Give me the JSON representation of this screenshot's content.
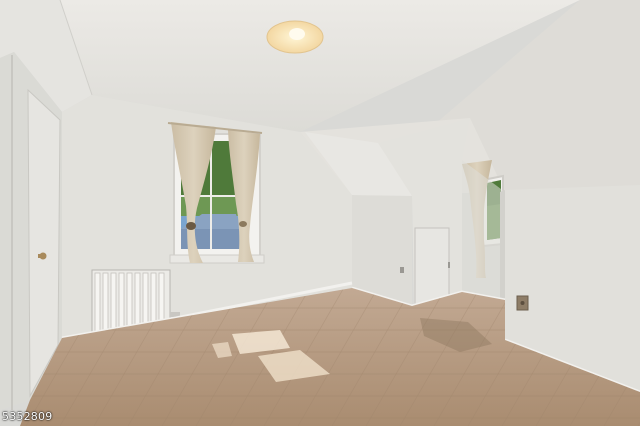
{
  "photo": {
    "listing_id": "5352809"
  },
  "palette": {
    "ceiling": "#e7e6e2",
    "wall": "#e2e1dc",
    "floor": "#b59a80",
    "curtain": "#d2c5ad",
    "window_green": "#4f7a3a",
    "radiator": "#ecebe7"
  }
}
